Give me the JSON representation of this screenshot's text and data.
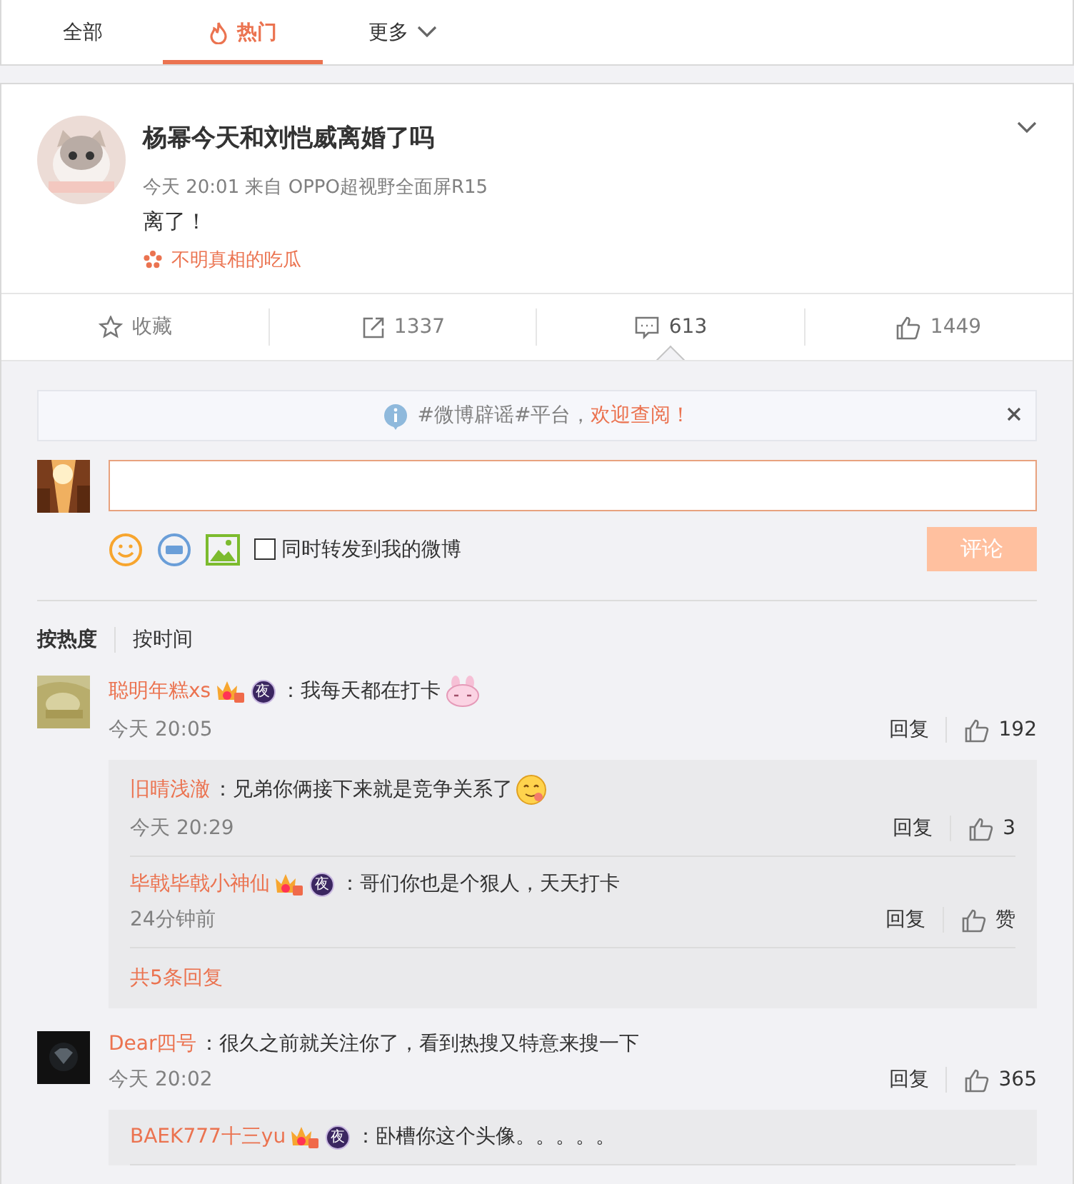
{
  "tabs": [
    {
      "label": "全部",
      "kind": "plain",
      "selected": false
    },
    {
      "label": "热门",
      "kind": "hot",
      "selected": true
    },
    {
      "label": "更多",
      "kind": "dropdown",
      "selected": false
    }
  ],
  "post": {
    "title": "杨幂今天和刘恺威离婚了吗",
    "meta": "今天 20:01 来自 OPPO超视野全面屏R15",
    "text": "离了！",
    "tag": "不明真相的吃瓜"
  },
  "actions": [
    {
      "kind": "favorite",
      "label": "收藏",
      "selected": false
    },
    {
      "kind": "repost",
      "label": "1337",
      "selected": false
    },
    {
      "kind": "comment",
      "label": "613",
      "selected": true
    },
    {
      "kind": "like",
      "label": "1449",
      "selected": false
    }
  ],
  "notice": {
    "text": "#微博辟谣#平台，",
    "link": "欢迎查阅！"
  },
  "composer": {
    "checkbox_label": "同时转发到我的微博",
    "checked": false,
    "submit": "评论",
    "disabled": true
  },
  "sort": [
    {
      "label": "按热度",
      "selected": true
    },
    {
      "label": "按时间",
      "selected": false
    }
  ],
  "comments": [
    {
      "user": "聪明年糕xs",
      "badges": [
        {
          "kind": "vip"
        },
        {
          "kind": "night",
          "text": "夜"
        }
      ],
      "text": "：我每天都在打卡",
      "kind": "bunny",
      "time": "今天 20:05",
      "reply": "回复",
      "likes": "192",
      "replies": [
        {
          "user": "旧晴浅澈",
          "text": "：兄弟你俩接下来就是竞争关系了",
          "kind": "yum",
          "time": "今天 20:29",
          "reply": "回复",
          "likes": "3"
        },
        {
          "user": "毕戟毕戟小神仙",
          "badges": [
            {
              "kind": "vip"
            },
            {
              "kind": "night",
              "text": "夜"
            }
          ],
          "text": "：哥们你也是个狠人，天天打卡",
          "time": "24分钟前",
          "reply": "回复",
          "likes": "赞"
        }
      ],
      "more": "共5条回复"
    },
    {
      "user": "Dear四号",
      "text": "：很久之前就关注你了，看到热搜又特意来搜一下",
      "time": "今天 20:02",
      "reply": "回复",
      "likes": "365",
      "replies": [
        {
          "user": "BAEK777十三yu",
          "badges": [
            {
              "kind": "vip"
            },
            {
              "kind": "night",
              "text": "夜"
            }
          ],
          "text": "：卧槽你这个头像。。。。。"
        }
      ]
    }
  ]
}
